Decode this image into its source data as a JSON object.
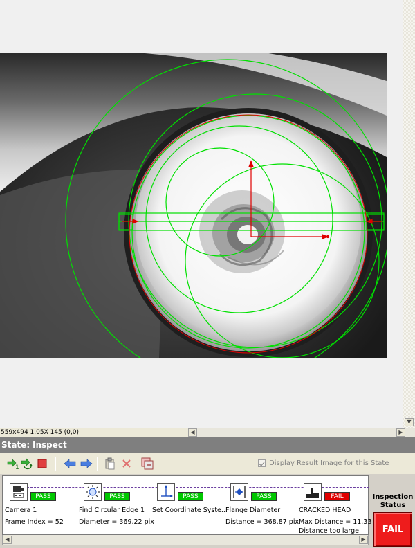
{
  "image_status": {
    "info": "559x494 1.05X 145   (0,0)"
  },
  "state": {
    "label": "State:",
    "value": "Inspect"
  },
  "toolbar": {
    "display_result_label": "Display Result Image for this State",
    "display_result_checked": true,
    "buttons": [
      "run-once-icon",
      "run-continuous-icon",
      "stop-icon",
      "step-back-icon",
      "step-forward-icon",
      "paste-step-icon",
      "delete-step-icon",
      "copy-state-icon"
    ]
  },
  "steps": [
    {
      "icon": "camera-icon",
      "name": "Camera 1",
      "status": "PASS",
      "result": "Frame Index = 52",
      "result2": ""
    },
    {
      "icon": "circular-edge-icon",
      "name": "Find Circular Edge 1",
      "status": "PASS",
      "result": "Diameter = 369.22 pix",
      "result2": ""
    },
    {
      "icon": "coordinate-system-icon",
      "name": "Set Coordinate Syste...",
      "status": "PASS",
      "result": "",
      "result2": ""
    },
    {
      "icon": "caliper-icon",
      "name": "Flange Diameter",
      "status": "PASS",
      "result": "Distance = 368.87 pix",
      "result2": ""
    },
    {
      "icon": "threshold-icon",
      "name": "CRACKED HEAD",
      "status": "FAIL",
      "result": "Max Distance = 11.33",
      "result2": "Distance too large"
    }
  ],
  "inspection_status": {
    "title": "Inspection Status",
    "value": "FAIL"
  },
  "colors": {
    "pass": "#00c800",
    "fail": "#e00000",
    "overlay_green": "#00e000",
    "overlay_red": "#e00000"
  }
}
